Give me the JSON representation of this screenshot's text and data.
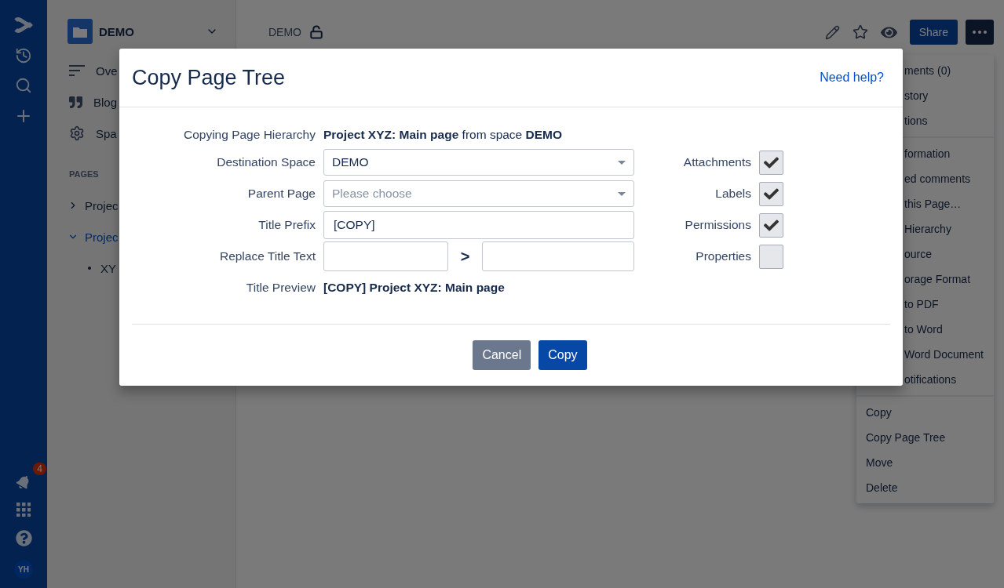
{
  "global_nav": {
    "notification_count": "4",
    "avatar": "YH"
  },
  "sidebar": {
    "space": "DEMO",
    "items": [
      {
        "label": "Ove",
        "kind": "overview"
      },
      {
        "label": "Blog",
        "kind": "blog"
      },
      {
        "label": "Spa",
        "kind": "settings"
      }
    ],
    "section_title": "PAGES",
    "tree": [
      {
        "label": "Projec",
        "expanded": false,
        "selected": false
      },
      {
        "label": "Projec",
        "expanded": true,
        "selected": true,
        "children": [
          {
            "label": "XY"
          }
        ]
      }
    ]
  },
  "header": {
    "breadcrumb": "DEMO",
    "share": "Share"
  },
  "menu": {
    "sections": [
      {
        "items": [
          "ments (0)",
          "story",
          "tions"
        ]
      },
      {
        "items": [
          "formation",
          "ed comments",
          "this Page…",
          "Hierarchy",
          "ource",
          "orage Format",
          "to PDF",
          "to Word",
          "Word Document",
          "otifications"
        ]
      },
      {
        "items": [
          "Copy",
          "Copy Page Tree",
          "Move",
          "Delete"
        ]
      }
    ]
  },
  "dialog": {
    "title": "Copy Page Tree",
    "help_link": "Need help?",
    "copying_label": "Copying Page Hierarchy",
    "copying_text": "**Project XYZ: Main page** from space **DEMO**",
    "fields": [
      {
        "label": "Destination Space",
        "kind": "select",
        "value": "DEMO"
      },
      {
        "label": "Parent Page",
        "kind": "select",
        "placeholder": "Please choose"
      },
      {
        "label": "Title Prefix",
        "kind": "text",
        "value": "[COPY]"
      },
      {
        "label": "Replace Title Text",
        "kind": "replace",
        "separator": ">"
      }
    ],
    "preview_label": "Title Preview",
    "preview": "[COPY] Project XYZ: Main page",
    "options": [
      {
        "label": "Attachments",
        "checked": true
      },
      {
        "label": "Labels",
        "checked": true
      },
      {
        "label": "Permissions",
        "checked": true
      },
      {
        "label": "Properties",
        "checked": false
      }
    ],
    "buttons": [
      {
        "label": "Cancel",
        "kind": "secondary"
      },
      {
        "label": "Copy",
        "kind": "primary"
      }
    ]
  }
}
